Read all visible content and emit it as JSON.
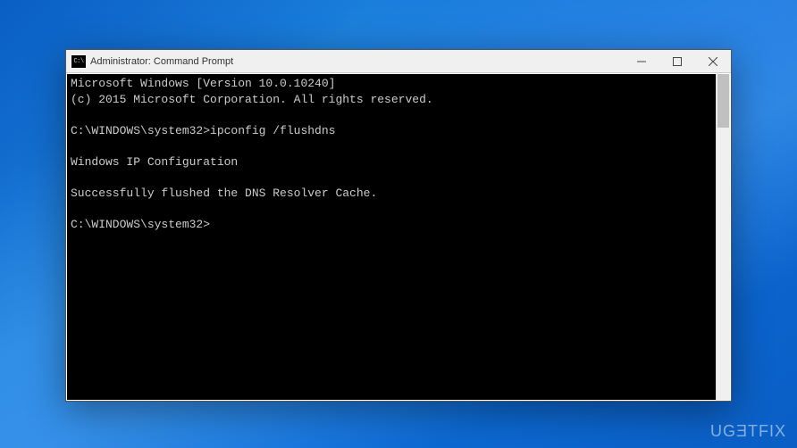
{
  "window": {
    "title": "Administrator: Command Prompt",
    "icon_label": "C:\\"
  },
  "console": {
    "lines": [
      "Microsoft Windows [Version 10.0.10240]",
      "(c) 2015 Microsoft Corporation. All rights reserved.",
      "",
      "C:\\WINDOWS\\system32>ipconfig /flushdns",
      "",
      "Windows IP Configuration",
      "",
      "Successfully flushed the DNS Resolver Cache.",
      "",
      "C:\\WINDOWS\\system32>"
    ]
  },
  "watermark": "UGƎTFIX"
}
